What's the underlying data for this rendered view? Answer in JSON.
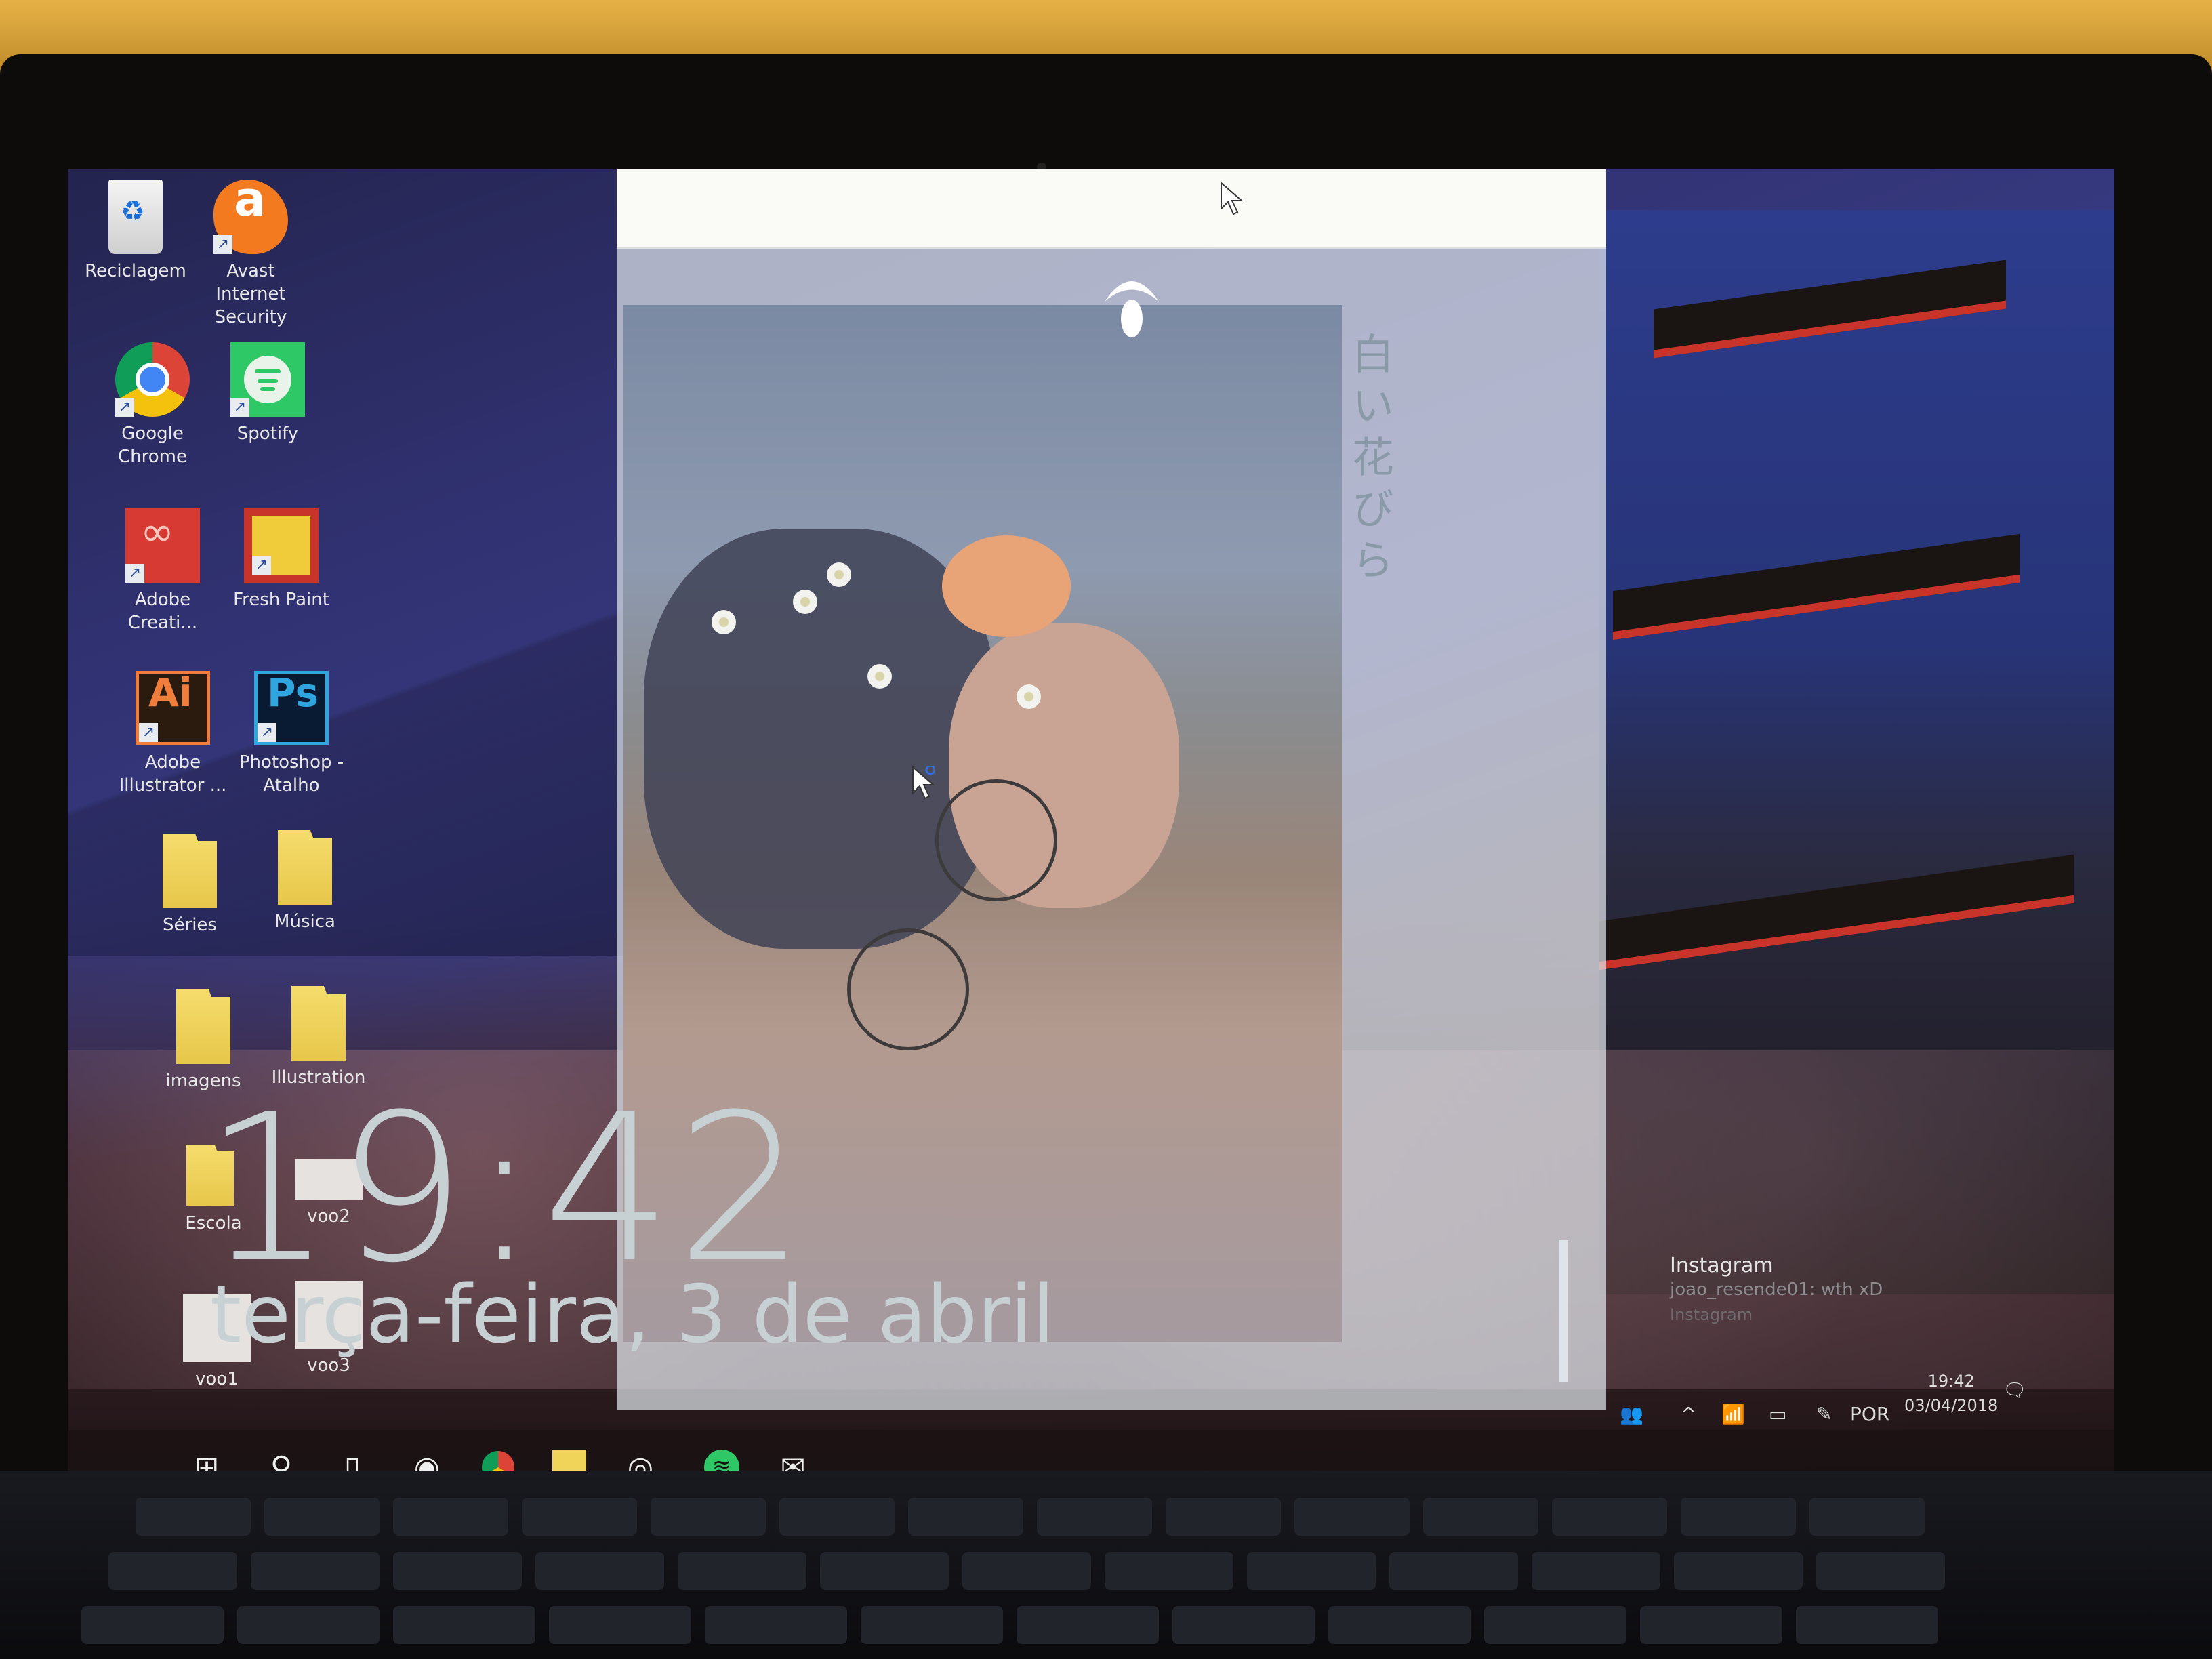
{
  "desktop": {
    "icons": [
      {
        "name": "recycle-bin",
        "label": "Reciclagem"
      },
      {
        "name": "avast",
        "label": "Avast Internet Security"
      },
      {
        "name": "google-chrome",
        "label": "Google Chrome"
      },
      {
        "name": "spotify",
        "label": "Spotify"
      },
      {
        "name": "adobe-creative-cloud",
        "label": "Adobe Creati..."
      },
      {
        "name": "fresh-paint",
        "label": "Fresh Paint"
      },
      {
        "name": "adobe-illustrator",
        "label": "Adobe Illustrator ..."
      },
      {
        "name": "photoshop",
        "label": "Photoshop - Atalho"
      },
      {
        "name": "series-folder",
        "label": "Séries"
      },
      {
        "name": "musica-folder",
        "label": "Música"
      },
      {
        "name": "imagens-folder",
        "label": "imagens"
      },
      {
        "name": "illustration-folder",
        "label": "Illustration"
      },
      {
        "name": "escola-folder",
        "label": "Escola"
      },
      {
        "name": "voo2-file",
        "label": "voo2"
      },
      {
        "name": "voo1-file",
        "label": "voo1"
      },
      {
        "name": "voo3-file",
        "label": "voo3"
      }
    ],
    "glyphs": {
      "avast": "a",
      "creative_cloud": "∞",
      "illustrator": "Ai",
      "photoshop": "Ps",
      "recycle": "♻",
      "shortcut": "↗"
    }
  },
  "lockscreen": {
    "time": "19:42",
    "date": "terça-feira, 3 de abril",
    "wallpaper_caption": "白い花びら"
  },
  "notification": {
    "app": "Instagram",
    "message": "joao_resende01: wth xD",
    "source": "Instagram"
  },
  "taskbar": {
    "items": [
      {
        "name": "start",
        "glyph": "⊞"
      },
      {
        "name": "search",
        "glyph": "⚲"
      },
      {
        "name": "task-view",
        "glyph": "▯"
      },
      {
        "name": "camera",
        "glyph": "◉"
      },
      {
        "name": "chrome",
        "glyph": ""
      },
      {
        "name": "file-explorer",
        "glyph": ""
      },
      {
        "name": "groove-music",
        "glyph": "◎"
      },
      {
        "name": "spotify",
        "glyph": "≋",
        "active": true
      },
      {
        "name": "mail",
        "glyph": "✉"
      }
    ],
    "tray": {
      "people": "👥",
      "chevron": "^",
      "wifi": "📶",
      "battery": "▭",
      "pen": "✎",
      "language": "POR",
      "time": "19:42",
      "date": "03/04/2018",
      "notifications": "🗨"
    }
  },
  "colors": {
    "accent": "#e7782c",
    "spotify": "#2ec866",
    "avast": "#f47a20"
  }
}
